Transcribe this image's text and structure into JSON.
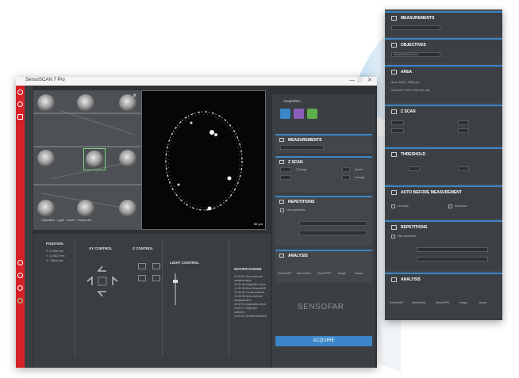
{
  "window": {
    "title": "SensoSCAN 7 Pro",
    "controls": {
      "minimize": "—",
      "maximize": "□",
      "close": "✕"
    }
  },
  "image_panes": {
    "close_glyph": "×",
    "info_text": "Objective · Light · Zoom · Exposure",
    "scale_label": "50 µm"
  },
  "acquisition": {
    "header_label": "Acquisition",
    "sections": [
      {
        "label": "MEASUREMENTS",
        "icon": "ruler-icon"
      },
      {
        "label": "Z SCAN",
        "icon": "zscan-icon"
      },
      {
        "label": "REPETITIONS",
        "icon": "repeat-icon"
      },
      {
        "label": "ANALYSIS",
        "icon": "analysis-icon"
      }
    ],
    "zscan_labels": {
      "range": "Z Range",
      "speed": "Speed",
      "average": "Average"
    },
    "repetitions_label": "Use repetitions",
    "analysis_items": [
      "SensoMAP",
      "SensoView",
      "SensoPRO",
      "Image",
      "Values"
    ],
    "brand": "SENSOFAR",
    "acquire_button": "ACQUIRE"
  },
  "bottom": {
    "position_title": "POSITION",
    "xy_control_title": "XY CONTROL",
    "z_control_title": "Z CONTROL",
    "light_control_title": "LIGHT CONTROL",
    "notifications_title": "NOTIFICATIONS",
    "position_values": [
      "X: 0.1695 mm",
      "Y: 12.6823 mm",
      "Z: 7.8543 mm"
    ],
    "notifications": [
      "10:32:51 New confocal measurement",
      "10:32:49 Acquisition done",
      "10:32:45 New SensoMAP",
      "10:32:40 Z scan finished",
      "10:32:38 New confocal measurement",
      "10:32:31 Acquisition done",
      "10:32:27 Objective selected",
      "10:32:20 Sensor initialized"
    ]
  },
  "settings_card": {
    "measurements_label": "MEASUREMENTS",
    "objectives_label": "OBJECTIVES",
    "objective_value": "SENSOFAR P40 EI",
    "area_label": "AREA",
    "area_lines": [
      "Area: 3340 x 2550 µm²",
      "Comment: 3.50 x 3.50 mm with"
    ],
    "zscan_label": "Z SCAN",
    "threshold_label": "THRESHOLD",
    "auto_label": "AUTO BEFORE MEASUREMENT",
    "auto_opts": [
      "Autolight",
      "Autofocus"
    ],
    "repetitions_label": "REPETITIONS",
    "use_repetitions": "Use repetitions",
    "analysis_label": "ANALYSIS",
    "analysis_items": [
      "SensoMAP",
      "SensoView",
      "SensoPRO",
      "Image",
      "Values"
    ]
  },
  "colors": {
    "accent": "#3a86c8",
    "brand_red": "#d62128",
    "panel": "#3b3f44"
  }
}
